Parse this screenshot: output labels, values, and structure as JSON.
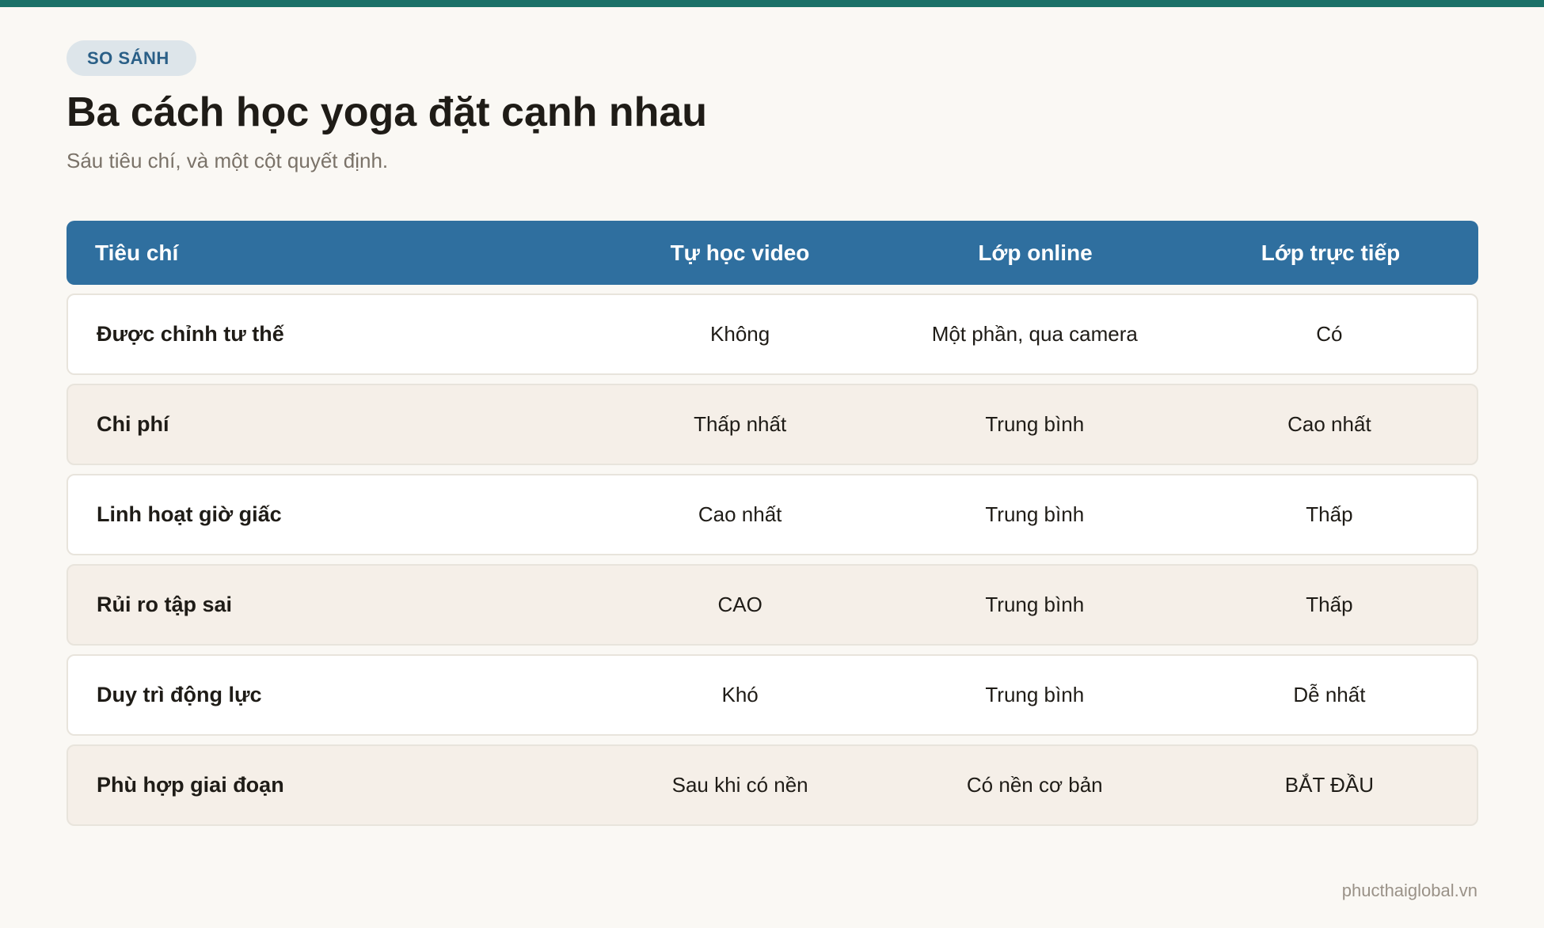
{
  "colors": {
    "accent_bar": "#1b7168",
    "header_bg": "#2f6f9f",
    "badge_bg": "#dde5ea",
    "badge_text": "#2a5f87",
    "row_tint": "#f5efe8",
    "row_white": "#ffffff"
  },
  "badge": "SO SÁNH",
  "title": "Ba cách học yoga đặt cạnh nhau",
  "subtitle": "Sáu tiêu chí, và một cột quyết định.",
  "table": {
    "headers": [
      "Tiêu chí",
      "Tự học video",
      "Lớp online",
      "Lớp trực tiếp"
    ],
    "rows": [
      [
        "Được chỉnh tư thế",
        "Không",
        "Một phần, qua camera",
        "Có"
      ],
      [
        "Chi phí",
        "Thấp nhất",
        "Trung bình",
        "Cao nhất"
      ],
      [
        "Linh hoạt giờ giấc",
        "Cao nhất",
        "Trung bình",
        "Thấp"
      ],
      [
        "Rủi ro tập sai",
        "CAO",
        "Trung bình",
        "Thấp"
      ],
      [
        "Duy trì động lực",
        "Khó",
        "Trung bình",
        "Dễ nhất"
      ],
      [
        "Phù hợp giai đoạn",
        "Sau khi có nền",
        "Có nền cơ bản",
        "BẮT ĐẦU"
      ]
    ]
  },
  "footer": "phucthaiglobal.vn"
}
